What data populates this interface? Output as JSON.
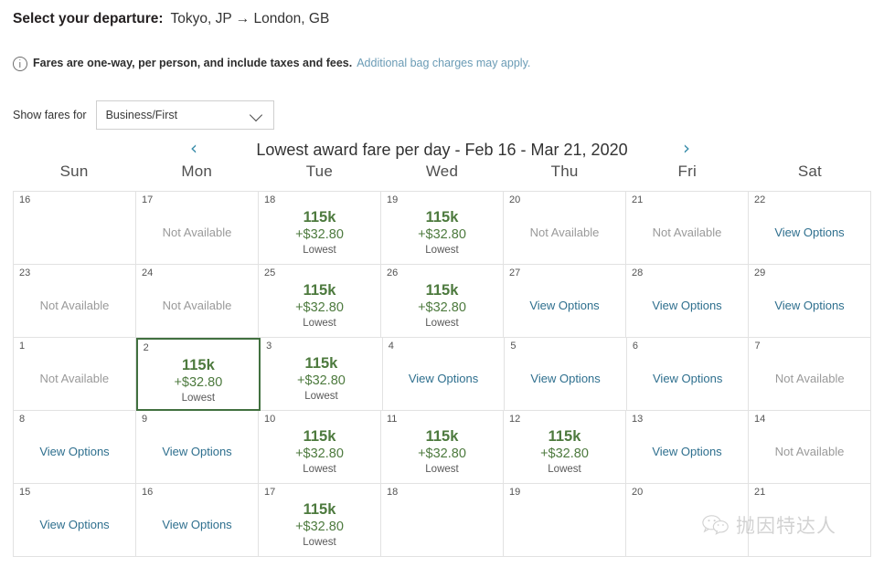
{
  "header": {
    "departure_label": "Select your departure:",
    "route": "Tokyo, JP → London, GB"
  },
  "fare_note": {
    "icon": "info-icon",
    "text": "Fares are one-way, per person, and include taxes and fees.",
    "link_text": "Additional bag charges may apply.",
    "link_color": "#6a9bb5"
  },
  "fare_filter": {
    "label": "Show fares for",
    "selected": "Business/First",
    "chevron_icon": "chevron-down-icon"
  },
  "calendar": {
    "title": "Lowest award fare per day - Feb 16 - Mar 21, 2020",
    "prev_icon": "chevron-left-icon",
    "next_icon": "chevron-right-icon",
    "prev_label": "‹",
    "next_label": "›",
    "weekdays": [
      "Sun",
      "Mon",
      "Tue",
      "Wed",
      "Thu",
      "Fri",
      "Sat"
    ],
    "accent_green": "#4d7a3e",
    "selected_border": "#41703f",
    "link_blue": "#2e6f8e",
    "muted_gray": "#9a9a9a",
    "labels": {
      "not_available": "Not Available",
      "view_options": "View Options",
      "lowest": "Lowest"
    },
    "weeks": [
      [
        {
          "day": "16",
          "type": "empty"
        },
        {
          "day": "17",
          "type": "unavailable",
          "text": "Not Available"
        },
        {
          "day": "18",
          "type": "fare",
          "points": "115k",
          "cash": "+$32.80",
          "tag": "Lowest"
        },
        {
          "day": "19",
          "type": "fare",
          "points": "115k",
          "cash": "+$32.80",
          "tag": "Lowest"
        },
        {
          "day": "20",
          "type": "unavailable",
          "text": "Not Available"
        },
        {
          "day": "21",
          "type": "unavailable",
          "text": "Not Available"
        },
        {
          "day": "22",
          "type": "options",
          "text": "View Options"
        }
      ],
      [
        {
          "day": "23",
          "type": "unavailable",
          "text": "Not Available"
        },
        {
          "day": "24",
          "type": "unavailable",
          "text": "Not Available"
        },
        {
          "day": "25",
          "type": "fare",
          "points": "115k",
          "cash": "+$32.80",
          "tag": "Lowest"
        },
        {
          "day": "26",
          "type": "fare",
          "points": "115k",
          "cash": "+$32.80",
          "tag": "Lowest"
        },
        {
          "day": "27",
          "type": "options",
          "text": "View Options"
        },
        {
          "day": "28",
          "type": "options",
          "text": "View Options"
        },
        {
          "day": "29",
          "type": "options",
          "text": "View Options"
        }
      ],
      [
        {
          "day": "1",
          "type": "unavailable",
          "text": "Not Available"
        },
        {
          "day": "2",
          "type": "fare",
          "points": "115k",
          "cash": "+$32.80",
          "tag": "Lowest",
          "selected": true
        },
        {
          "day": "3",
          "type": "fare",
          "points": "115k",
          "cash": "+$32.80",
          "tag": "Lowest"
        },
        {
          "day": "4",
          "type": "options",
          "text": "View Options"
        },
        {
          "day": "5",
          "type": "options",
          "text": "View Options"
        },
        {
          "day": "6",
          "type": "options",
          "text": "View Options"
        },
        {
          "day": "7",
          "type": "unavailable",
          "text": "Not Available"
        }
      ],
      [
        {
          "day": "8",
          "type": "options",
          "text": "View Options"
        },
        {
          "day": "9",
          "type": "options",
          "text": "View Options"
        },
        {
          "day": "10",
          "type": "fare",
          "points": "115k",
          "cash": "+$32.80",
          "tag": "Lowest"
        },
        {
          "day": "11",
          "type": "fare",
          "points": "115k",
          "cash": "+$32.80",
          "tag": "Lowest"
        },
        {
          "day": "12",
          "type": "fare",
          "points": "115k",
          "cash": "+$32.80",
          "tag": "Lowest"
        },
        {
          "day": "13",
          "type": "options",
          "text": "View Options"
        },
        {
          "day": "14",
          "type": "unavailable",
          "text": "Not Available"
        }
      ],
      [
        {
          "day": "15",
          "type": "options",
          "text": "View Options"
        },
        {
          "day": "16",
          "type": "options",
          "text": "View Options"
        },
        {
          "day": "17",
          "type": "fare",
          "points": "115k",
          "cash": "+$32.80",
          "tag": "Lowest"
        },
        {
          "day": "18",
          "type": "empty"
        },
        {
          "day": "19",
          "type": "empty"
        },
        {
          "day": "20",
          "type": "empty"
        },
        {
          "day": "21",
          "type": "empty"
        }
      ]
    ]
  },
  "watermark": {
    "icon": "wechat-logo-icon",
    "text": "抛因特达人"
  }
}
